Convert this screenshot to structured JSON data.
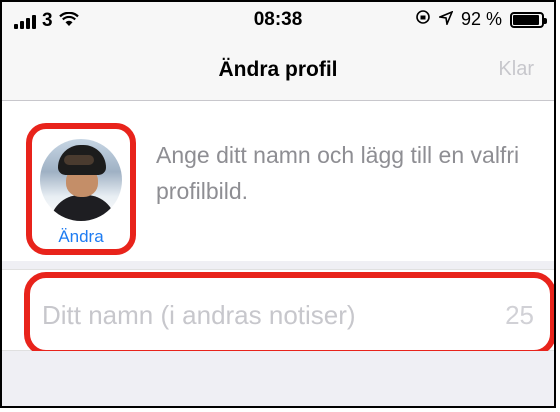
{
  "status_bar": {
    "carrier": "3",
    "time": "08:38",
    "battery_text": "92 %",
    "battery_level": 0.92,
    "icons": [
      "signal-icon",
      "wifi-icon",
      "rotation-lock-icon",
      "location-icon",
      "battery-icon"
    ]
  },
  "nav": {
    "title": "Ändra profil",
    "done_label": "Klar"
  },
  "profile": {
    "edit_label": "Ändra",
    "hint": "Ange ditt namn och lägg till en valfri profilbild."
  },
  "name_field": {
    "value": "",
    "placeholder": "Ditt namn (i andras notiser)",
    "remaining": "25"
  },
  "colors": {
    "accent": "#1e7cf2",
    "highlight": "#e8231b",
    "placeholder": "#c7c7cc"
  }
}
